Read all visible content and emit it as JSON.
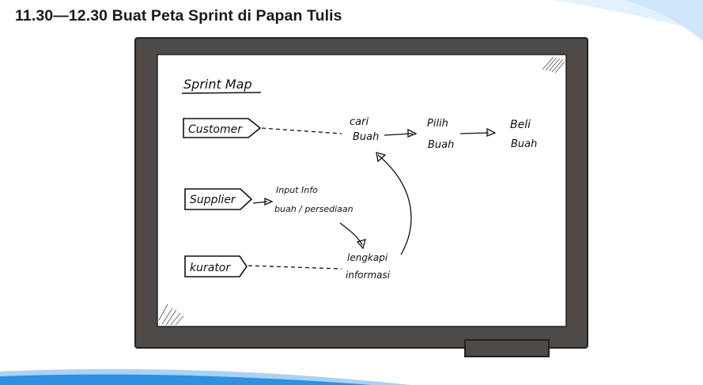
{
  "page": {
    "title": "11.30—12.30 Buat Peta Sprint di Papan Tulis"
  },
  "colors": {
    "board_frame": "#4d4a47",
    "board_surface": "#ffffff",
    "ink": "#111111",
    "accent_wave": "#2f8fe0",
    "accent_wave_light": "#d8ecfb"
  },
  "whiteboard": {
    "heading": "Sprint Map",
    "actors": {
      "customer": "Customer",
      "supplier": "Supplier",
      "kurator": "kurator"
    },
    "steps": {
      "cari_line1": "cari",
      "cari_line2": "Buah",
      "pilih_line1": "Pilih",
      "pilih_line2": "Buah",
      "beli_line1": "Beli",
      "beli_line2": "Buah",
      "input_line1": "Input Info",
      "input_line2": "buah / persediaan",
      "lengkapi_line1": "lengkapi",
      "lengkapi_line2": "informasi"
    }
  }
}
